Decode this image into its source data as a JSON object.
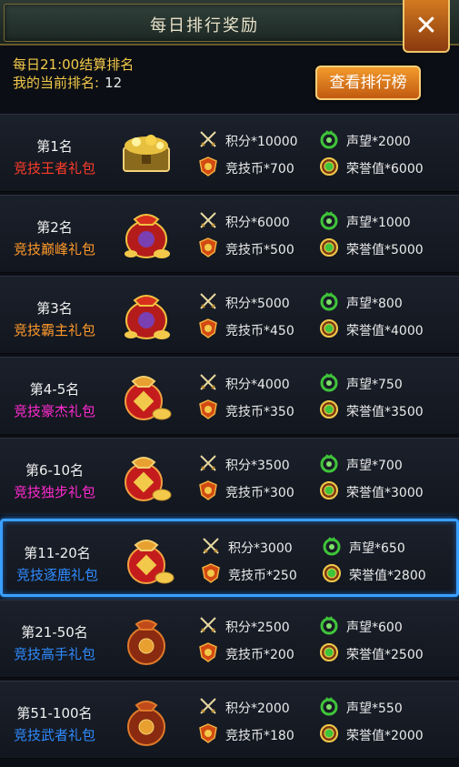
{
  "header": {
    "title": "每日排行奖励"
  },
  "info": {
    "settle_text": "每日21:00结算排名",
    "rank_label": "我的当前排名:",
    "rank_value": "12"
  },
  "buttons": {
    "view_ranking": "查看排行榜",
    "close": "✕"
  },
  "colors": {
    "gold": "#f2c94a",
    "red": "#ff3c2a",
    "orange": "#ff9a2a",
    "magenta": "#ff2ad0",
    "blue": "#2f8cff",
    "selected_border": "#3aa0ff"
  },
  "rows": [
    {
      "rank": "第1名",
      "gift": "竞技王者礼包",
      "gift_color": "#ff3c2a",
      "gift_icon": "treasure-chest-icon",
      "points": "积分*10000",
      "coin": "竞技币*700",
      "fame": "声望*2000",
      "honor": "荣誉值*6000"
    },
    {
      "rank": "第2名",
      "gift": "竞技巅峰礼包",
      "gift_color": "#ff9a2a",
      "gift_icon": "gold-bag-icon",
      "points": "积分*6000",
      "coin": "竞技币*500",
      "fame": "声望*1000",
      "honor": "荣誉值*5000"
    },
    {
      "rank": "第3名",
      "gift": "竞技霸主礼包",
      "gift_color": "#ff9a2a",
      "gift_icon": "gold-bag-icon",
      "points": "积分*5000",
      "coin": "竞技币*450",
      "fame": "声望*800",
      "honor": "荣誉值*4000"
    },
    {
      "rank": "第4-5名",
      "gift": "竞技豪杰礼包",
      "gift_color": "#ff2ad0",
      "gift_icon": "red-bag-icon",
      "points": "积分*4000",
      "coin": "竞技币*350",
      "fame": "声望*750",
      "honor": "荣誉值*3500"
    },
    {
      "rank": "第6-10名",
      "gift": "竞技独步礼包",
      "gift_color": "#ff2ad0",
      "gift_icon": "red-bag-icon",
      "points": "积分*3500",
      "coin": "竞技币*300",
      "fame": "声望*700",
      "honor": "荣誉值*3000"
    },
    {
      "rank": "第11-20名",
      "gift": "竞技逐鹿礼包",
      "gift_color": "#2f8cff",
      "gift_icon": "red-bag-icon",
      "points": "积分*3000",
      "coin": "竞技币*250",
      "fame": "声望*650",
      "honor": "荣誉值*2800"
    },
    {
      "rank": "第21-50名",
      "gift": "竞技高手礼包",
      "gift_color": "#2f8cff",
      "gift_icon": "brown-pouch-icon",
      "points": "积分*2500",
      "coin": "竞技币*200",
      "fame": "声望*600",
      "honor": "荣誉值*2500"
    },
    {
      "rank": "第51-100名",
      "gift": "竞技武者礼包",
      "gift_color": "#2f8cff",
      "gift_icon": "brown-pouch-icon",
      "points": "积分*2000",
      "coin": "竞技币*180",
      "fame": "声望*550",
      "honor": "荣誉值*2000"
    }
  ],
  "selected_row": 5,
  "reward_icons": {
    "points": "crossed-swords-icon",
    "coin": "arena-coin-icon",
    "fame": "green-dragon-icon",
    "honor": "honor-medal-icon"
  }
}
